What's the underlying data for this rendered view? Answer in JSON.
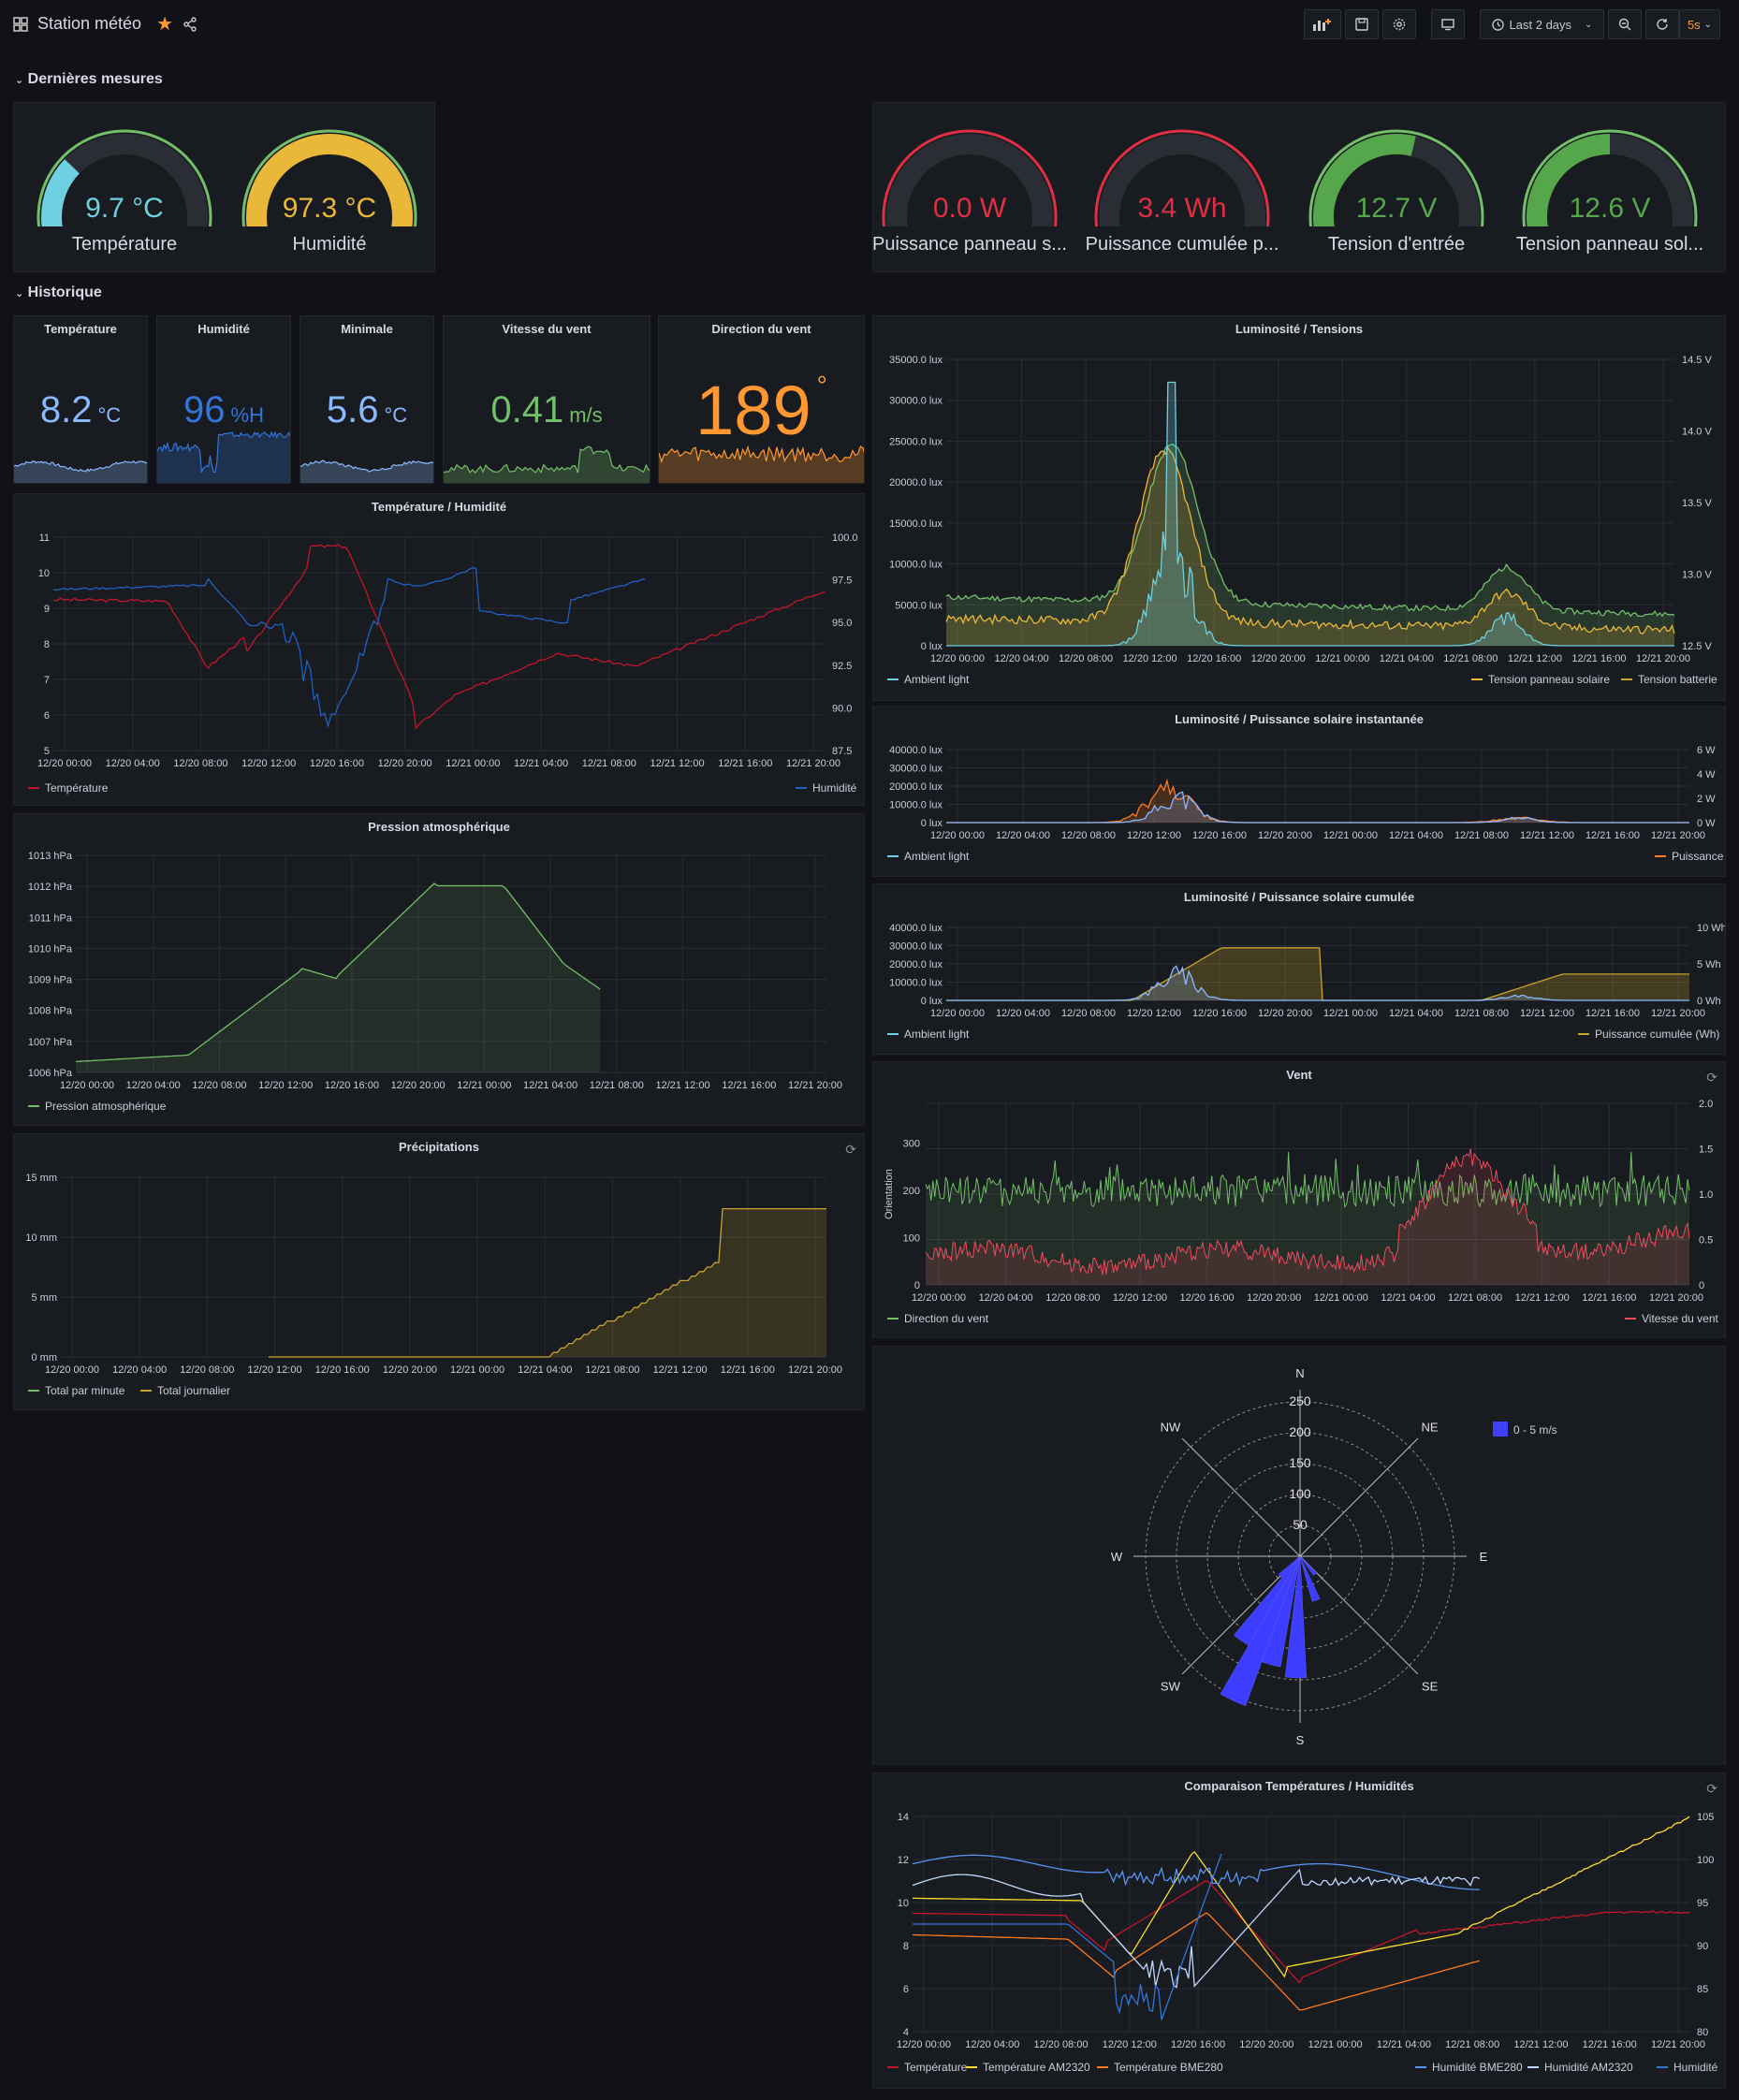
{
  "topbar": {
    "title": "Station météo",
    "time_range": "Last 2 days",
    "refresh_interval": "5s"
  },
  "rows": {
    "latest": "Dernières mesures",
    "history": "Historique"
  },
  "gauges": [
    {
      "value": "9.7 °C",
      "label": "Température",
      "fraction": 0.33,
      "color": "#6ed0e0"
    },
    {
      "value": "97.3 °C",
      "label": "Humidité",
      "fraction": 0.97,
      "color": "#eab839"
    },
    {
      "value": "0.0 W",
      "label": "Puissance panneau s...",
      "fraction": 0.0,
      "color": "#e02f44"
    },
    {
      "value": "3.4 Wh",
      "label": "Puissance cumulée p...",
      "fraction": 0.08,
      "color": "#e02f44"
    },
    {
      "value": "12.7 V",
      "label": "Tension d'entrée",
      "fraction": 0.55,
      "color": "#56a64b"
    },
    {
      "value": "12.6 V",
      "label": "Tension panneau sol...",
      "fraction": 0.5,
      "color": "#56a64b"
    }
  ],
  "stats": [
    {
      "title": "Température",
      "value": "8.2",
      "unit": "°C",
      "color": "#8ab8ff"
    },
    {
      "title": "Humidité",
      "value": "96",
      "unit": "%H",
      "color": "#3274d9"
    },
    {
      "title": "Minimale",
      "value": "5.6",
      "unit": "°C",
      "color": "#8ab8ff"
    },
    {
      "title": "Vitesse du vent",
      "value": "0.41",
      "unit": "m/s",
      "color": "#73bf69"
    },
    {
      "title": "Direction du vent",
      "value": "189",
      "unit": "°",
      "color": "#ff9830"
    }
  ],
  "charts": {
    "temp_hum": {
      "title": "Température / Humidité",
      "y_left": [
        "11",
        "10",
        "9",
        "8",
        "7",
        "6",
        "5"
      ],
      "y_right": [
        "100.0",
        "97.5",
        "95.0",
        "92.5",
        "90.0",
        "87.5"
      ],
      "x_ticks": [
        "12/20 00:00",
        "12/20 04:00",
        "12/20 08:00",
        "12/20 12:00",
        "12/20 16:00",
        "12/20 20:00",
        "12/21 00:00",
        "12/21 04:00",
        "12/21 08:00",
        "12/21 12:00",
        "12/21 16:00",
        "12/21 20:00"
      ],
      "legend_left": "Température",
      "legend_right": "Humidité"
    },
    "pression": {
      "title": "Pression atmosphérique",
      "y_left": [
        "1013 hPa",
        "1012 hPa",
        "1011 hPa",
        "1010 hPa",
        "1009 hPa",
        "1008 hPa",
        "1007 hPa",
        "1006 hPa"
      ],
      "x_ticks": [
        "12/20 00:00",
        "12/20 04:00",
        "12/20 08:00",
        "12/20 12:00",
        "12/20 16:00",
        "12/20 20:00",
        "12/21 00:00",
        "12/21 04:00",
        "12/21 08:00",
        "12/21 12:00",
        "12/21 16:00",
        "12/21 20:00"
      ],
      "legend": "Pression atmosphérique"
    },
    "precip": {
      "title": "Précipitations",
      "y_left": [
        "15 mm",
        "10 mm",
        "5 mm",
        "0 mm"
      ],
      "x_ticks": [
        "12/20 00:00",
        "12/20 04:00",
        "12/20 08:00",
        "12/20 12:00",
        "12/20 16:00",
        "12/20 20:00",
        "12/21 00:00",
        "12/21 04:00",
        "12/21 08:00",
        "12/21 12:00",
        "12/21 16:00",
        "12/21 20:00"
      ],
      "legend_1": "Total par minute",
      "legend_2": "Total journalier"
    },
    "lum_tension": {
      "title": "Luminosité / Tensions",
      "y_left": [
        "35000.0 lux",
        "30000.0 lux",
        "25000.0 lux",
        "20000.0 lux",
        "15000.0 lux",
        "10000.0 lux",
        "5000.0 lux",
        "0 lux"
      ],
      "y_right": [
        "14.5 V",
        "14.0 V",
        "13.5 V",
        "13.0 V",
        "12.5 V"
      ],
      "x_ticks": [
        "12/20 00:00",
        "12/20 04:00",
        "12/20 08:00",
        "12/20 12:00",
        "12/20 16:00",
        "12/20 20:00",
        "12/21 00:00",
        "12/21 04:00",
        "12/21 08:00",
        "12/21 12:00",
        "12/21 16:00",
        "12/21 20:00"
      ],
      "legend_left": "Ambient light",
      "legend_r1": "Tension panneau solaire",
      "legend_r2": "Tension batterie"
    },
    "lum_inst": {
      "title": "Luminosité / Puissance solaire instantanée",
      "y_left": [
        "40000.0 lux",
        "30000.0 lux",
        "20000.0 lux",
        "10000.0 lux",
        "0 lux"
      ],
      "y_right": [
        "6 W",
        "4 W",
        "2 W",
        "0 W"
      ],
      "x_ticks": [
        "12/20 00:00",
        "12/20 04:00",
        "12/20 08:00",
        "12/20 12:00",
        "12/20 16:00",
        "12/20 20:00",
        "12/21 00:00",
        "12/21 04:00",
        "12/21 08:00",
        "12/21 12:00",
        "12/21 16:00",
        "12/21 20:00"
      ],
      "legend_left": "Ambient light",
      "legend_right": "Puissance"
    },
    "lum_cum": {
      "title": "Luminosité / Puissance solaire cumulée",
      "y_left": [
        "40000.0 lux",
        "30000.0 lux",
        "20000.0 lux",
        "10000.0 lux",
        "0 lux"
      ],
      "y_right": [
        "10 Wh",
        "5 Wh",
        "0 Wh"
      ],
      "x_ticks": [
        "12/20 00:00",
        "12/20 04:00",
        "12/20 08:00",
        "12/20 12:00",
        "12/20 16:00",
        "12/20 20:00",
        "12/21 00:00",
        "12/21 04:00",
        "12/21 08:00",
        "12/21 12:00",
        "12/21 16:00",
        "12/21 20:00"
      ],
      "legend_left": "Ambient light",
      "legend_right": "Puissance cumulée (Wh)"
    },
    "vent": {
      "title": "Vent",
      "y_left": [
        "300",
        "200",
        "100",
        "0"
      ],
      "y_right": [
        "2.0",
        "1.5",
        "1.0",
        "0.5",
        "0"
      ],
      "y_axis_label": "Orientation",
      "x_ticks": [
        "12/20 00:00",
        "12/20 04:00",
        "12/20 08:00",
        "12/20 12:00",
        "12/20 16:00",
        "12/20 20:00",
        "12/21 00:00",
        "12/21 04:00",
        "12/21 08:00",
        "12/21 12:00",
        "12/21 16:00",
        "12/21 20:00"
      ],
      "legend_left": "Direction du vent",
      "legend_right": "Vitesse du vent"
    },
    "rose": {
      "directions": [
        "N",
        "NE",
        "E",
        "SE",
        "S",
        "SW",
        "W",
        "NW"
      ],
      "rings": [
        "250",
        "200",
        "150",
        "100",
        "50"
      ],
      "legend": "0 - 5 m/s"
    },
    "compare": {
      "title": "Comparaison Températures / Humidités",
      "y_left": [
        "14",
        "12",
        "10",
        "8",
        "6",
        "4"
      ],
      "y_right": [
        "105",
        "100",
        "95",
        "90",
        "85",
        "80"
      ],
      "x_ticks": [
        "12/20 00:00",
        "12/20 04:00",
        "12/20 08:00",
        "12/20 12:00",
        "12/20 16:00",
        "12/20 20:00",
        "12/21 00:00",
        "12/21 04:00",
        "12/21 08:00",
        "12/21 12:00",
        "12/21 16:00",
        "12/21 20:00"
      ],
      "legend": [
        "Température",
        "Température AM2320",
        "Température BME280",
        "Humidité BME280",
        "Humidité AM2320",
        "Humidité"
      ]
    }
  }
}
